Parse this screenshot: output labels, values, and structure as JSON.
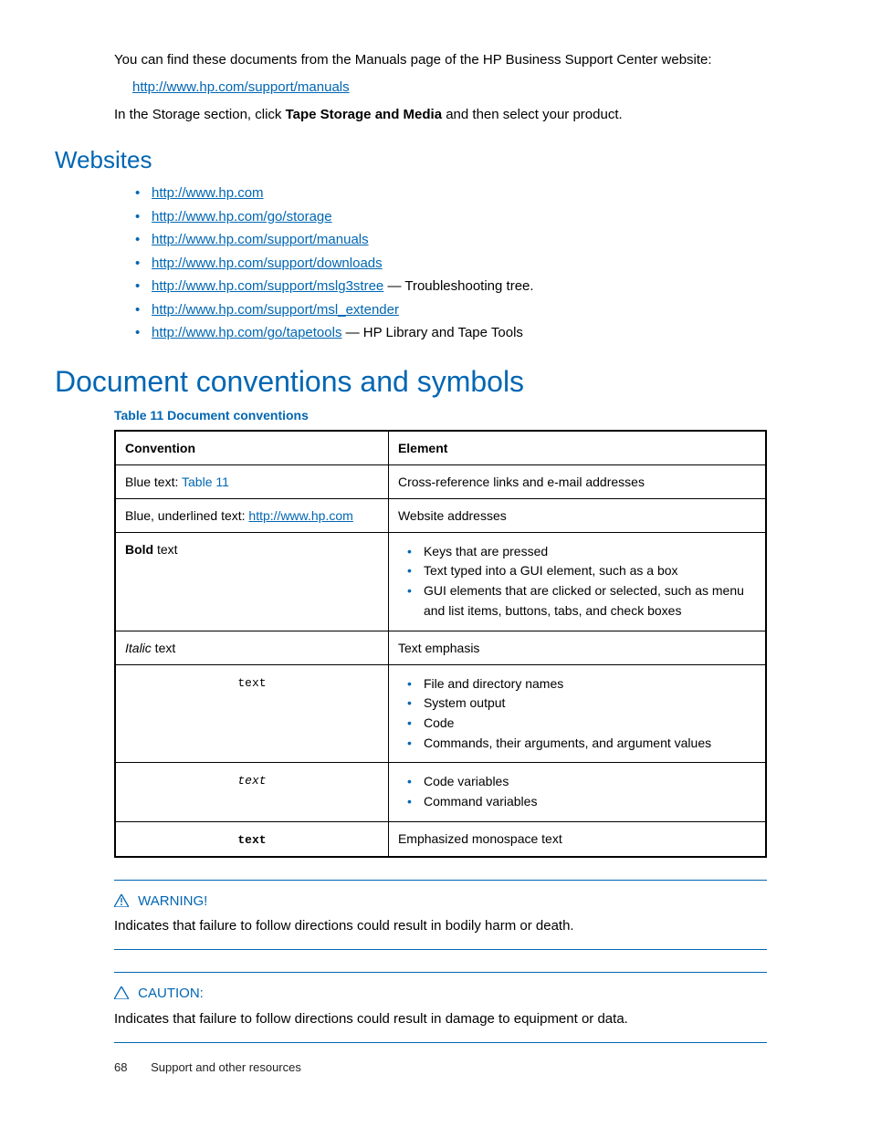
{
  "intro": {
    "p1": "You can find these documents from the Manuals page of the HP Business Support Center website:",
    "link": "http://www.hp.com/support/manuals",
    "p2_a": "In the Storage section, click ",
    "p2_b": "Tape Storage and Media",
    "p2_c": " and then select your product."
  },
  "websites": {
    "heading": "Websites",
    "items": [
      {
        "url": "http://www.hp.com",
        "tail": ""
      },
      {
        "url": "http://www.hp.com/go/storage",
        "tail": ""
      },
      {
        "url": "http://www.hp.com/support/manuals",
        "tail": ""
      },
      {
        "url": "http://www.hp.com/support/downloads",
        "tail": ""
      },
      {
        "url": "http://www.hp.com/support/mslg3stree",
        "tail": " — Troubleshooting tree."
      },
      {
        "url": "http://www.hp.com/support/msl_extender",
        "tail": ""
      },
      {
        "url": "http://www.hp.com/go/tapetools",
        "tail": " — HP Library and Tape Tools"
      }
    ]
  },
  "conventions": {
    "heading": "Document conventions and symbols",
    "caption": "Table 11 Document conventions",
    "th1": "Convention",
    "th2": "Element",
    "r1c1_a": "Blue text: ",
    "r1c1_b": "Table 11",
    "r1c2": "Cross-reference links and e-mail addresses",
    "r2c1_a": "Blue, underlined text: ",
    "r2c1_b": "http://www.hp.com",
    "r2c2": "Website addresses",
    "r3c1_a": "Bold",
    "r3c1_b": " text",
    "r3c2_items": [
      "Keys that are pressed",
      "Text typed into a GUI element, such as a box",
      "GUI elements that are clicked or selected, such as menu and list items, buttons, tabs, and check boxes"
    ],
    "r4c1_a": "Italic",
    "r4c1_b": "  text",
    "r4c2": "Text emphasis",
    "r5c1": " text",
    "r5c2_items": [
      "File and directory names",
      "System output",
      "Code",
      "Commands, their arguments, and argument values"
    ],
    "r6c1": " text",
    "r6c2_items": [
      "Code variables",
      "Command variables"
    ],
    "r7c1": " text",
    "r7c2": "Emphasized monospace text"
  },
  "alerts": {
    "warning_label": "WARNING!",
    "warning_text": "Indicates that failure to follow directions could result in bodily harm or death.",
    "caution_label": "CAUTION:",
    "caution_text": "Indicates that failure to follow directions could result in damage to equipment or data."
  },
  "footer": {
    "page": "68",
    "title": "Support and other resources"
  }
}
